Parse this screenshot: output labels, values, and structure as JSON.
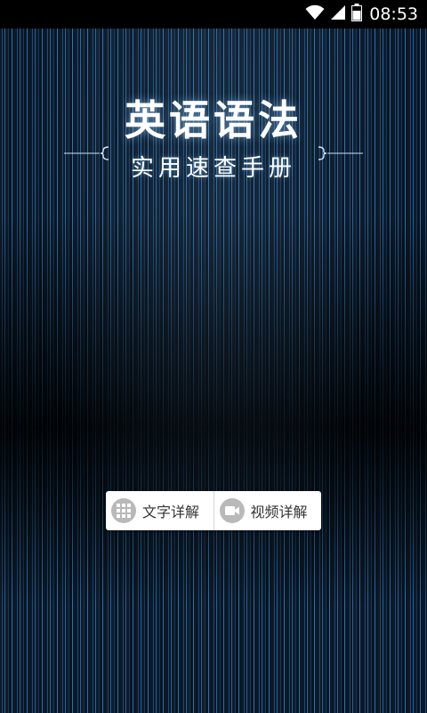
{
  "status_bar": {
    "time": "08:53",
    "icons": [
      "wifi-icon",
      "signal-icon",
      "battery-icon"
    ]
  },
  "title": {
    "main": "英语语法",
    "subtitle": "实用速查手册"
  },
  "buttons": {
    "text_detail": {
      "label": "文字详解",
      "icon": "grid-icon"
    },
    "video_detail": {
      "label": "视频详解",
      "icon": "video-camera-icon"
    }
  },
  "colors": {
    "background": "#0a1726",
    "stripe_accent": "#2a6496",
    "button_bg": "#ffffff",
    "button_text": "#333333",
    "icon_circle": "#b9b9b9"
  }
}
